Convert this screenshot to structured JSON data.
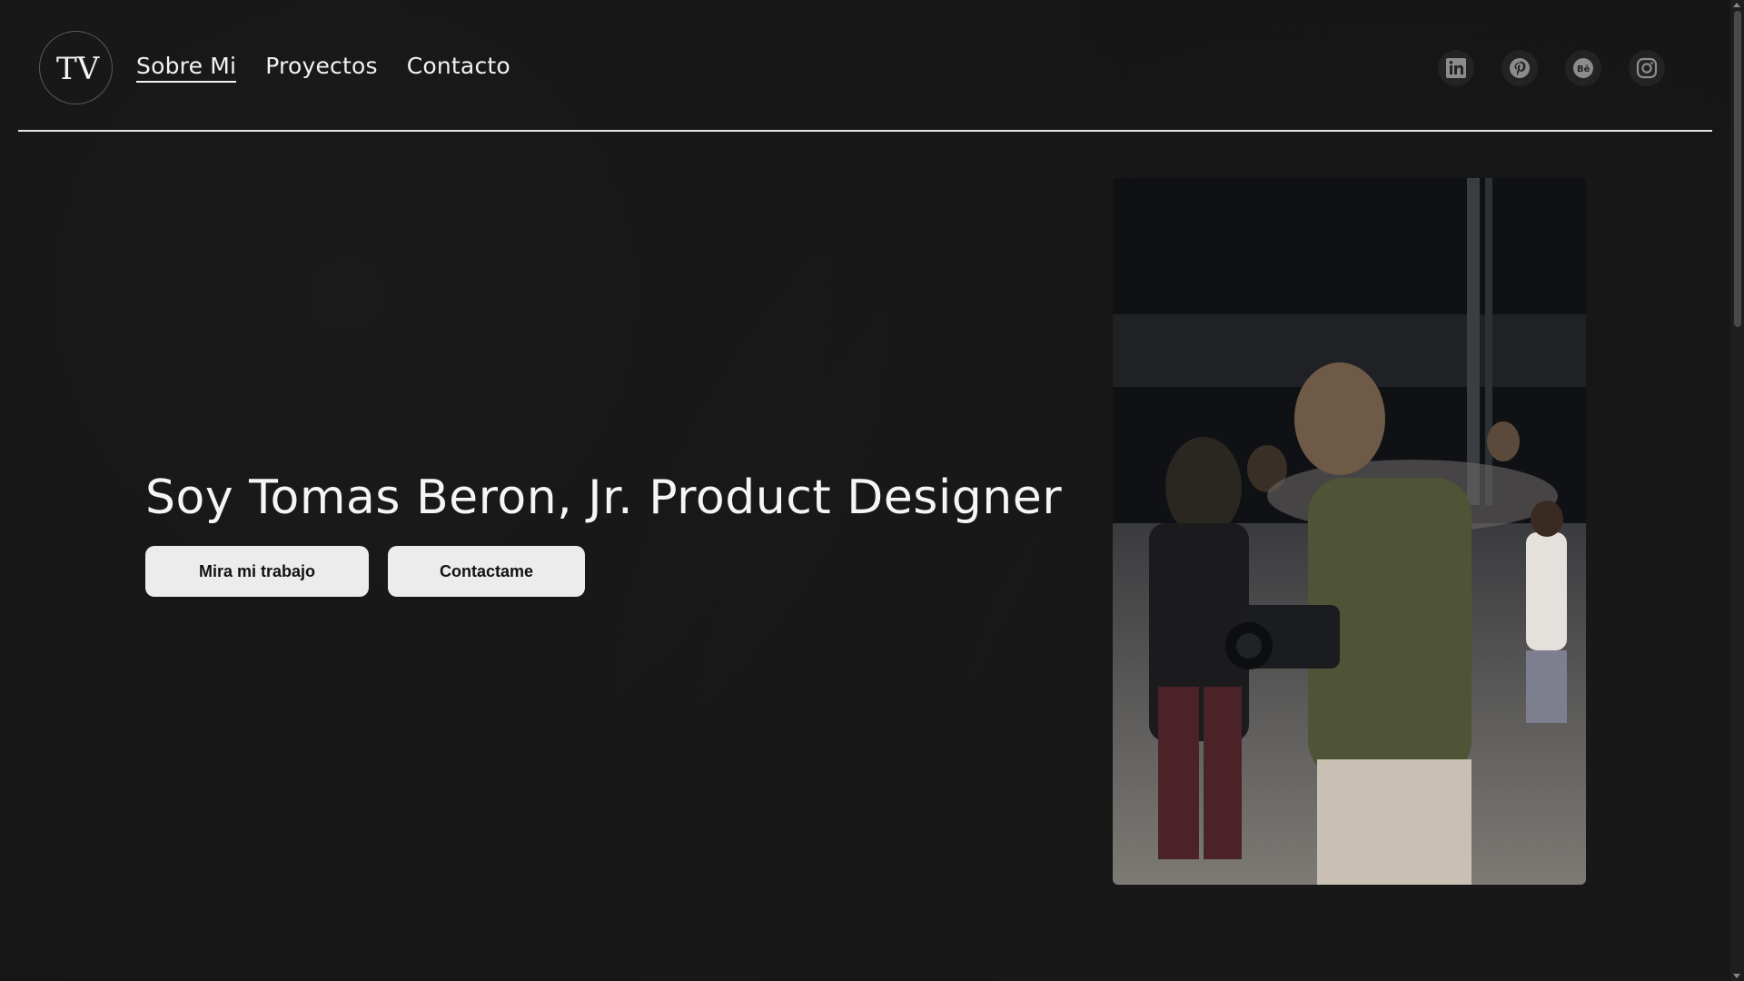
{
  "nav": {
    "items": [
      {
        "label": "Sobre Mi",
        "active": true
      },
      {
        "label": "Proyectos",
        "active": false
      },
      {
        "label": "Contacto",
        "active": false
      }
    ]
  },
  "logo": {
    "text": "TV"
  },
  "socials": [
    {
      "icon": "linkedin-icon"
    },
    {
      "icon": "pinterest-icon"
    },
    {
      "icon": "behance-icon",
      "text": "Bē"
    },
    {
      "icon": "instagram-icon"
    }
  ],
  "hero": {
    "title": "Soy Tomas Beron, Jr. Product Designer",
    "primary_button": "Mira mi trabajo",
    "secondary_button": "Contactame"
  },
  "colors": {
    "background": "#161616",
    "text": "#f2f2f2",
    "button_bg": "#ececec",
    "button_text": "#111111",
    "social_bg": "#232323",
    "icon": "#8c8c8c"
  }
}
